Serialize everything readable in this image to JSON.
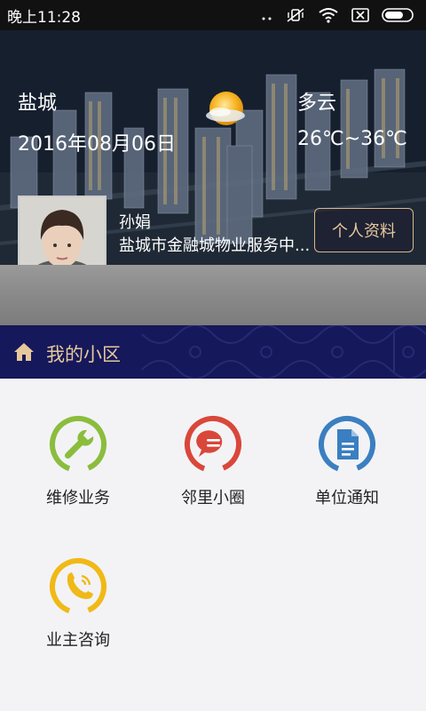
{
  "status_bar": {
    "time": "晚上11:28"
  },
  "header": {
    "city": "盐城",
    "weather": "多云",
    "date": "2016年08月06日",
    "temperature": "26℃~36℃"
  },
  "profile": {
    "name": "孙娟",
    "company": "盐城市金融城物业服务中...",
    "button_label": "个人资料"
  },
  "section": {
    "title": "我的小区"
  },
  "tiles": [
    {
      "label": "维修业务",
      "icon": "wrench-icon",
      "color": "#8bbd3d"
    },
    {
      "label": "邻里小圈",
      "icon": "chat-bubble-icon",
      "color": "#d9473a"
    },
    {
      "label": "单位通知",
      "icon": "document-icon",
      "color": "#3a7fc1"
    },
    {
      "label": "业主咨询",
      "icon": "phone-icon",
      "color": "#f0b917"
    }
  ],
  "colors": {
    "accent_gold": "#e7c89c",
    "section_bg": "#15185a"
  }
}
